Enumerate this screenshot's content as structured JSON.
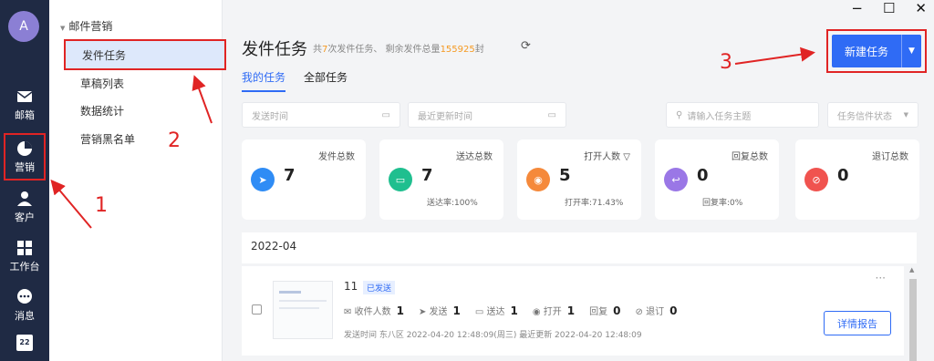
{
  "nav": {
    "avatar": "A",
    "items": [
      {
        "label": "邮箱",
        "icon": "mail-icon"
      },
      {
        "label": "营销",
        "icon": "pie-chart-icon"
      },
      {
        "label": "客户",
        "icon": "user-icon"
      },
      {
        "label": "工作台",
        "icon": "grid-icon"
      },
      {
        "label": "消息",
        "icon": "chat-icon"
      },
      {
        "label": "",
        "icon": "calendar-icon",
        "badge": "22"
      }
    ]
  },
  "subnav": {
    "group": "邮件营销",
    "items": [
      "发件任务",
      "草稿列表",
      "数据统计",
      "营销黑名单"
    ]
  },
  "window": {
    "minimize": "−",
    "maximize": "☐",
    "close": "✕"
  },
  "header": {
    "title": "发件任务",
    "summary_pre": "共",
    "task_count": "7",
    "summary_mid": "次发件任务、 剩余发件总量",
    "remaining": "155925",
    "summary_post": "封",
    "new_task_label": "新建任务"
  },
  "tabs": [
    "我的任务",
    "全部任务"
  ],
  "filters": {
    "send_time": "发送时间",
    "updated_time": "最近更新时间",
    "search_placeholder": "请输入任务主题",
    "status": "任务信件状态"
  },
  "cards": [
    {
      "title": "发件总数",
      "value": "7",
      "sub": "",
      "color": "#2f8cf5",
      "icon": "send-icon"
    },
    {
      "title": "送达总数",
      "value": "7",
      "sub": "送达率:100%",
      "color": "#1fbf8f",
      "icon": "inbox-icon"
    },
    {
      "title": "打开人数",
      "value": "5",
      "sub": "打开率:71.43%",
      "color": "#f5893b",
      "icon": "eye-icon"
    },
    {
      "title": "回复总数",
      "value": "0",
      "sub": "回复率:0%",
      "color": "#9a77e6",
      "icon": "reply-icon"
    },
    {
      "title": "退订总数",
      "value": "0",
      "sub": "",
      "color": "#f0534f",
      "icon": "unsubscribe-icon"
    }
  ],
  "month": "2022-04",
  "mail": {
    "subject": "11",
    "status": "已发送",
    "recipients_label": "收件人数",
    "recipients": "1",
    "sent_label": "发送",
    "sent": "1",
    "delivered_label": "送达",
    "delivered": "1",
    "opened_label": "打开",
    "opened": "1",
    "replied_label": "回复",
    "replied": "0",
    "unsub_label": "退订",
    "unsub": "0",
    "meta": "发送时间 东八区 2022-04-20 12:48:09(周三)   最近更新 2022-04-20 12:48:09",
    "detail_label": "详情报告",
    "more": "···"
  },
  "annotations": [
    "1",
    "2",
    "3"
  ]
}
